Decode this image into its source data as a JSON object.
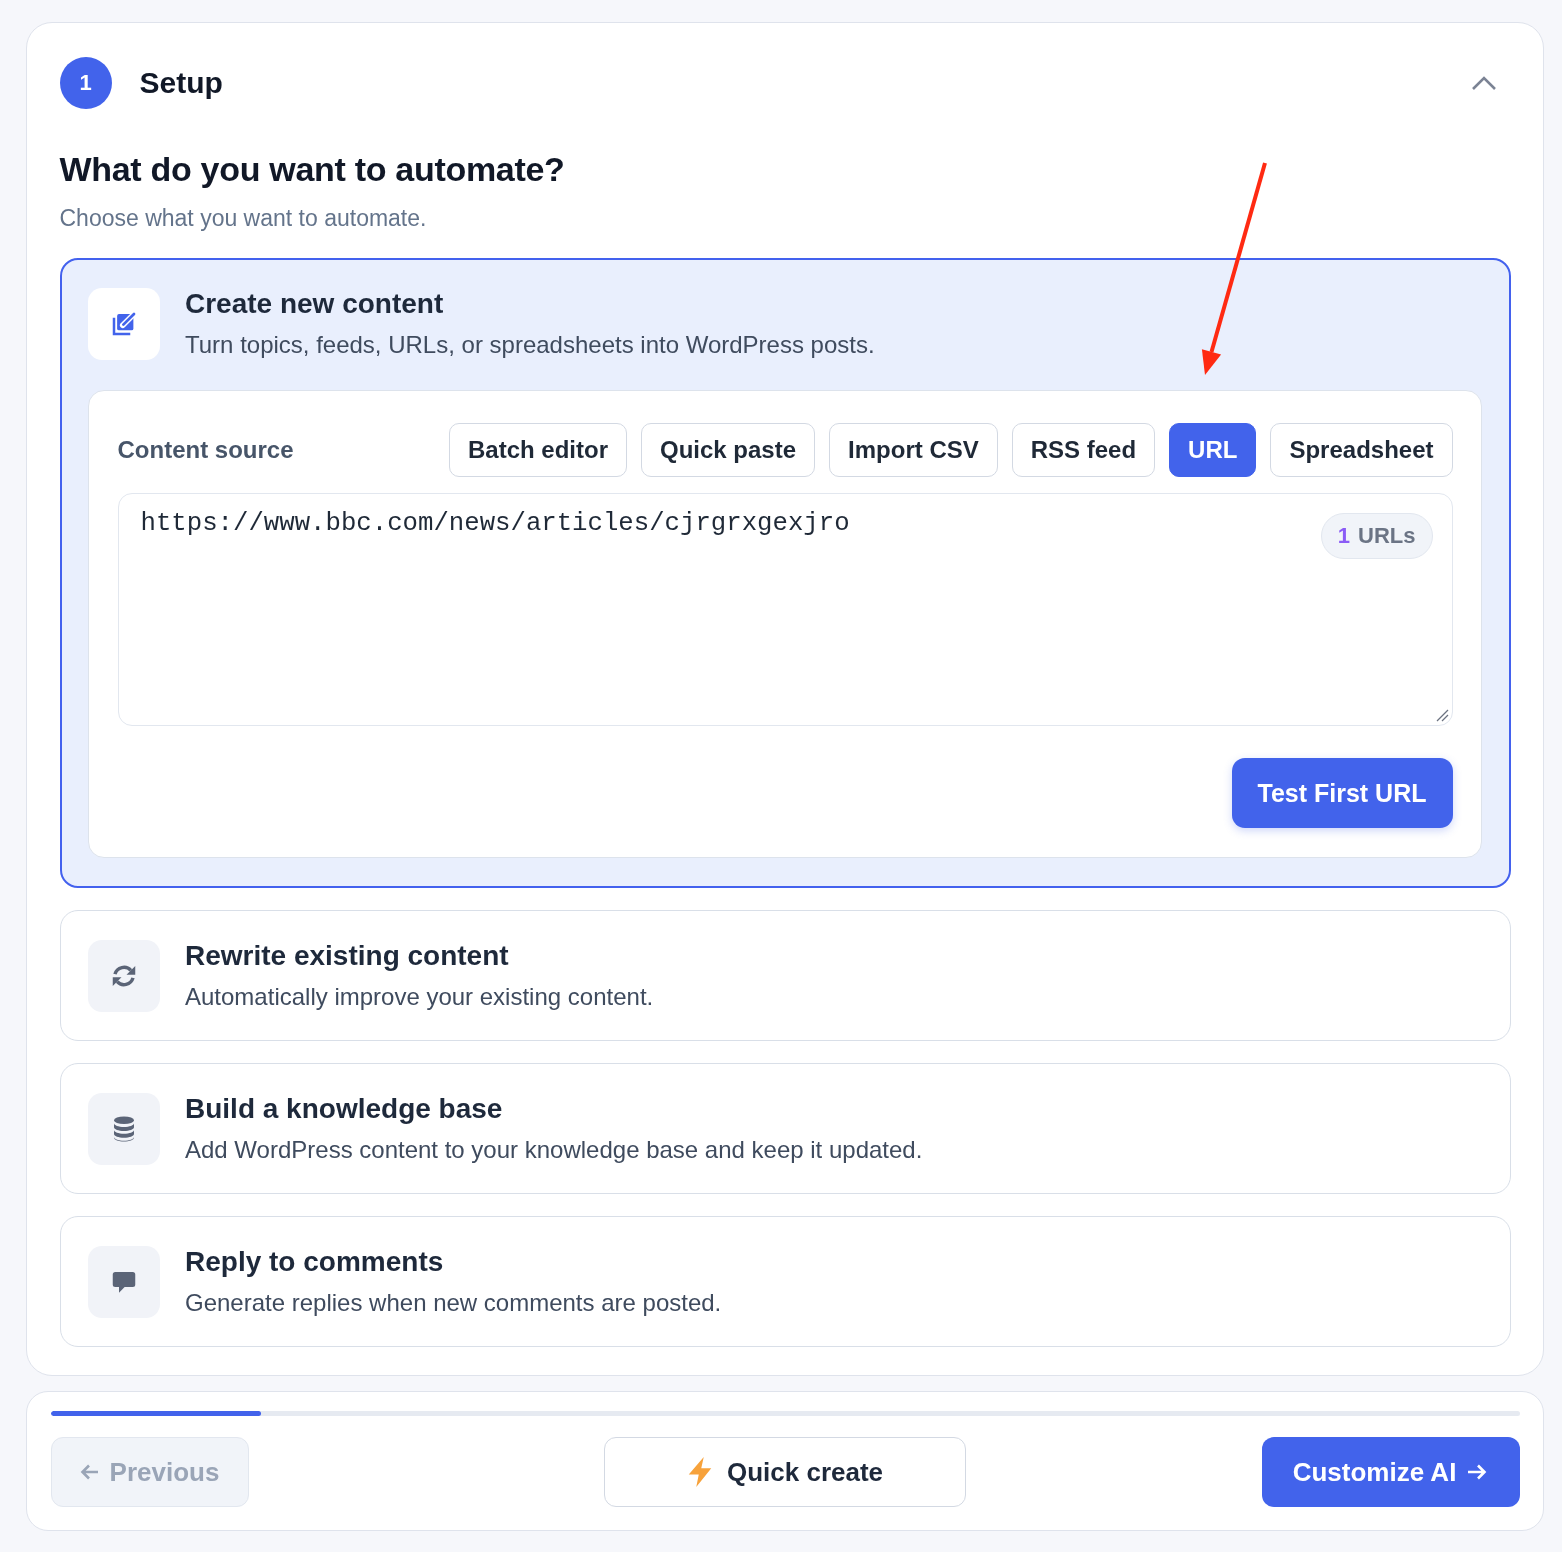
{
  "setup": {
    "step": "1",
    "title": "Setup",
    "expanded": true
  },
  "intro": {
    "heading": "What do you want to automate?",
    "subtitle": "Choose what you want to automate."
  },
  "options": [
    {
      "kind": "create",
      "title": "Create new content",
      "description": "Turn topics, feeds, URLs, or spreadsheets into WordPress posts.",
      "selected": true,
      "content_source": {
        "label": "Content source",
        "tabs": [
          {
            "label": "Batch editor",
            "selected": false
          },
          {
            "label": "Quick paste",
            "selected": false
          },
          {
            "label": "Import CSV",
            "selected": false
          },
          {
            "label": "RSS feed",
            "selected": false
          },
          {
            "label": "URL",
            "selected": true
          },
          {
            "label": "Spreadsheet",
            "selected": false
          }
        ],
        "urls": {
          "value": "https://www.bbc.com/news/articles/cjrgrxgexjro",
          "count": "1",
          "unit": "URLs"
        },
        "test_button": "Test First URL"
      }
    },
    {
      "kind": "rewrite",
      "title": "Rewrite existing content",
      "description": "Automatically improve your existing content.",
      "selected": false
    },
    {
      "kind": "knowledge",
      "title": "Build a knowledge base",
      "description": "Add WordPress content to your knowledge base and keep it updated.",
      "selected": false
    },
    {
      "kind": "reply",
      "title": "Reply to comments",
      "description": "Generate replies when new comments are posted.",
      "selected": false
    }
  ],
  "footer": {
    "progress": {
      "level": 0.143
    },
    "previous": {
      "label": "Previous",
      "disabled": true
    },
    "quick_create": "Quick create",
    "next": "Customize AI"
  },
  "annotation": {
    "kind": "arrow"
  }
}
